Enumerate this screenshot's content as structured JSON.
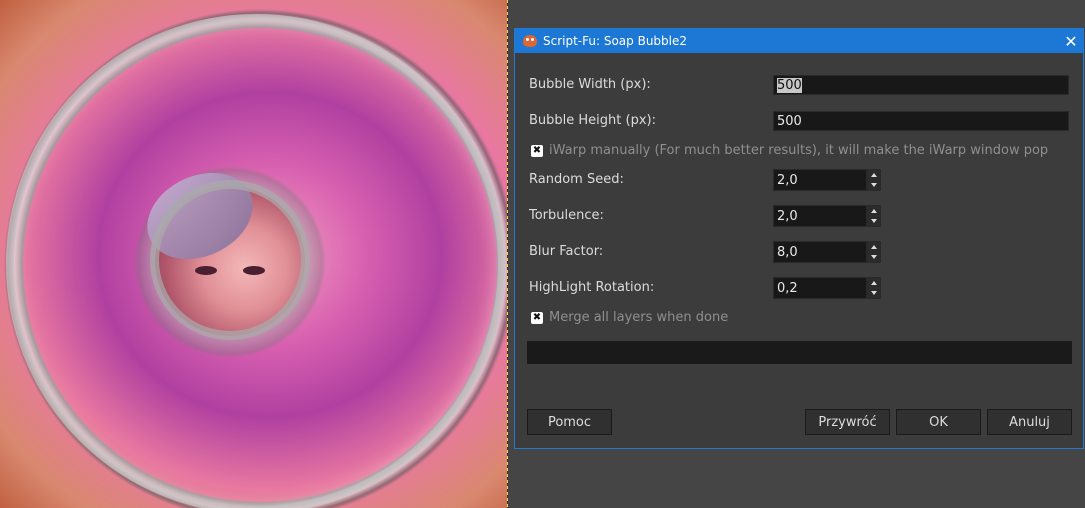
{
  "dialog": {
    "title": "Script-Fu: Soap Bubble2",
    "close_glyph": "✕",
    "fields": {
      "bubble_width": {
        "label": "Bubble Width (px):",
        "value": "500"
      },
      "bubble_height": {
        "label": "Bubble Height (px):",
        "value": "500"
      },
      "iwarp": {
        "label": "iWarp manually (For much better results), it will make the iWarp window pop",
        "checked": true
      },
      "random_seed": {
        "label": "Random Seed:",
        "value": "2,0"
      },
      "torbulence": {
        "label": "Torbulence:",
        "value": "2,0"
      },
      "blur_factor": {
        "label": "Blur Factor:",
        "value": "8,0"
      },
      "highlight_rotation": {
        "label": "HighLight Rotation:",
        "value": "0,2"
      },
      "merge": {
        "label": "Merge all layers when done",
        "checked": true
      }
    },
    "buttons": {
      "help": "Pomoc",
      "reset": "Przywróć",
      "ok": "OK",
      "cancel": "Anuluj"
    }
  },
  "icons": {
    "app": "gimp-wilber-icon",
    "close": "close-icon",
    "checkbox_mark": "✖"
  },
  "colors": {
    "titlebar": "#1c78d4",
    "dialog_bg": "#3c3c3c",
    "field_bg": "#181818"
  }
}
